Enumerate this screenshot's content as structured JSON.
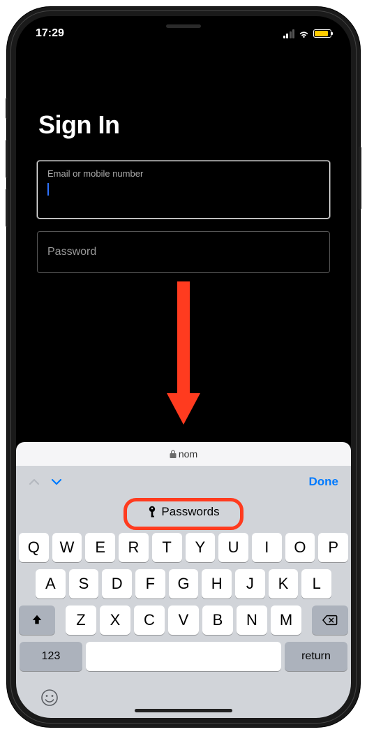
{
  "status": {
    "time": "17:29",
    "signal_bars": 4,
    "signal_active": 2
  },
  "page": {
    "title": "Sign In",
    "email_label": "Email or mobile number",
    "email_value": "",
    "password_placeholder": "Password"
  },
  "url_bar": {
    "domain_visible_prefix": "n",
    "domain_visible_suffix": "om"
  },
  "keyboard": {
    "done": "Done",
    "passwords_button": "Passwords",
    "row1": [
      "Q",
      "W",
      "E",
      "R",
      "T",
      "Y",
      "U",
      "I",
      "O",
      "P"
    ],
    "row2": [
      "A",
      "S",
      "D",
      "F",
      "G",
      "H",
      "J",
      "K",
      "L"
    ],
    "row3": [
      "Z",
      "X",
      "C",
      "V",
      "B",
      "N",
      "M"
    ],
    "num_key": "123",
    "return_key": "return",
    "emoji": "☺"
  }
}
